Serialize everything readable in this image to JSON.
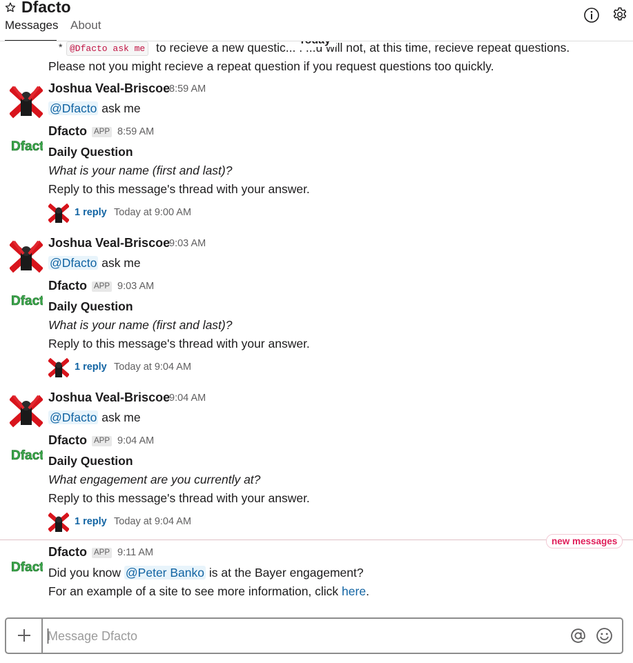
{
  "header": {
    "title": "Dfacto",
    "star_icon": "star-outline-icon",
    "tabs": [
      {
        "label": "Messages",
        "active": true
      },
      {
        "label": "About",
        "active": false
      }
    ],
    "info_icon": "info-icon",
    "settings_icon": "gear-icon"
  },
  "date_divider": "Today",
  "partial_message": {
    "bullet": "*",
    "code": "@Dfacto ask me",
    "line1_rest": "to recieve a new questic... . ...u will not, at this time, recieve repeat questions.",
    "line2": "Please not you might recieve a repeat question if you request questions too quickly."
  },
  "messages": [
    {
      "sender": "Joshua Veal-Briscoe",
      "time": "8:59 AM",
      "mention": "@Dfacto",
      "text": " ask me"
    },
    {
      "sender": "Dfacto",
      "badge": "APP",
      "time": "8:59 AM",
      "heading": "Daily Question",
      "question": "What is your name (first and last)?",
      "instruction": "Reply to this message's thread with your answer.",
      "reply_label": "1 reply",
      "reply_time": "Today at 9:00 AM"
    },
    {
      "sender": "Joshua Veal-Briscoe",
      "time": "9:03 AM",
      "mention": "@Dfacto",
      "text": " ask me"
    },
    {
      "sender": "Dfacto",
      "badge": "APP",
      "time": "9:03 AM",
      "heading": "Daily Question",
      "question": "What is your name (first and last)?",
      "instruction": "Reply to this message's thread with your answer.",
      "reply_label": "1 reply",
      "reply_time": "Today at 9:04 AM"
    },
    {
      "sender": "Joshua Veal-Briscoe",
      "time": "9:04 AM",
      "mention": "@Dfacto",
      "text": " ask me"
    },
    {
      "sender": "Dfacto",
      "badge": "APP",
      "time": "9:04 AM",
      "heading": "Daily Question",
      "question": "What engagement are you currently at?",
      "instruction": "Reply to this message's thread with your answer.",
      "reply_label": "1 reply",
      "reply_time": "Today at 9:04 AM"
    },
    {
      "sender": "Dfacto",
      "badge": "APP",
      "time": "9:11 AM",
      "line1_prefix": "Did you know ",
      "line1_mention": "@Peter Banko",
      "line1_suffix": " is at the Bayer engagement?",
      "line2_prefix": "For an example of a site to see more information, click ",
      "line2_link": "here",
      "line2_suffix": "."
    }
  ],
  "new_messages_label": "new messages",
  "composer": {
    "add_icon": "plus-icon",
    "placeholder": "Message Dfacto",
    "value": "",
    "mention_icon": "at-sign-icon",
    "emoji_icon": "smiley-icon"
  },
  "colors": {
    "link": "#1264a3",
    "mention_bg": "#e8f4fb",
    "new_messages": "#e01e5a",
    "code": "#c01343",
    "dfacto_green": "#3aa84a",
    "avatar_red": "#d8141c"
  }
}
